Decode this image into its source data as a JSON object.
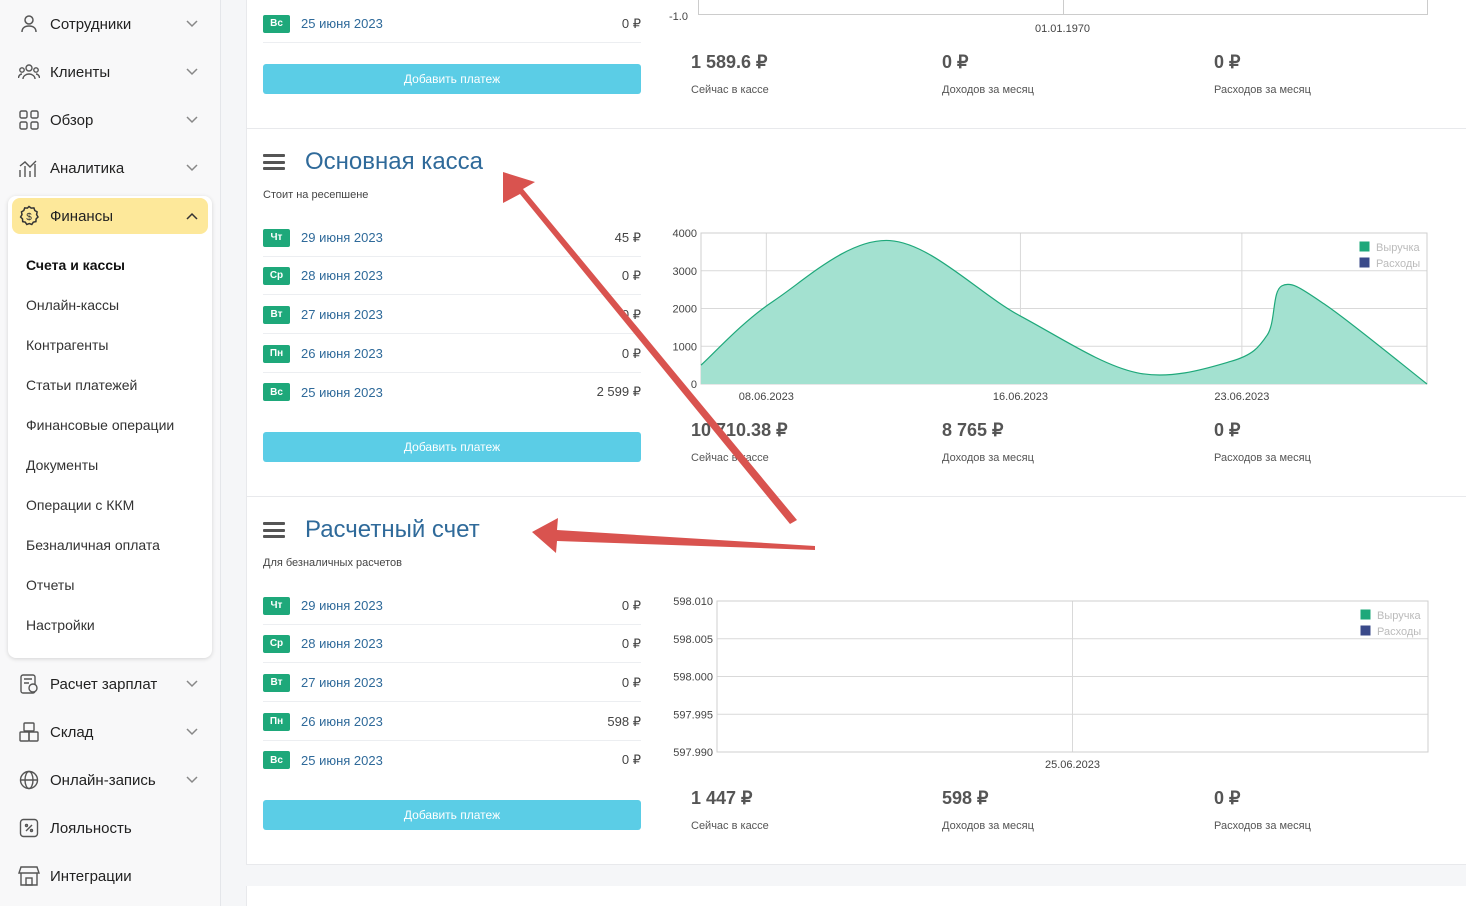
{
  "sidebar": {
    "items_top": [
      {
        "label": "Сотрудники",
        "icon": "user-icon"
      },
      {
        "label": "Клиенты",
        "icon": "users-icon"
      },
      {
        "label": "Обзор",
        "icon": "dashboard-icon"
      },
      {
        "label": "Аналитика",
        "icon": "analytics-icon"
      },
      {
        "label": "Финансы",
        "icon": "dollar-coin-icon"
      }
    ],
    "finance_sub": [
      "Счета и кассы",
      "Онлайн-кассы",
      "Контрагенты",
      "Статьи платежей",
      "Финансовые операции",
      "Документы",
      "Операции с ККМ",
      "Безналичная оплата",
      "Отчеты",
      "Настройки"
    ],
    "items_bottom": [
      {
        "label": "Расчет зарплат",
        "icon": "payroll-icon"
      },
      {
        "label": "Склад",
        "icon": "warehouse-icon"
      },
      {
        "label": "Онлайн-запись",
        "icon": "globe-icon"
      },
      {
        "label": "Лояльность",
        "icon": "discount-icon"
      },
      {
        "label": "Интеграции",
        "icon": "store-icon"
      }
    ]
  },
  "top_card": {
    "last_row": {
      "day": "Вс",
      "date": "25 июня 2023",
      "amount": "0 ₽"
    },
    "add_button": "Добавить платеж",
    "axis_min": "-1.0",
    "axis_date": "01.01.1970",
    "stats": [
      {
        "value": "1 589.6 ₽",
        "label": "Сейчас в кассе"
      },
      {
        "value": "0 ₽",
        "label": "Доходов за месяц"
      },
      {
        "value": "0 ₽",
        "label": "Расходов за месяц"
      }
    ]
  },
  "cards": [
    {
      "title": "Основная касса",
      "subtitle": "Стоит на ресепшене",
      "rows": [
        {
          "day": "Чт",
          "date": "29 июня 2023",
          "amount": "45 ₽"
        },
        {
          "day": "Ср",
          "date": "28 июня 2023",
          "amount": "0 ₽"
        },
        {
          "day": "Вт",
          "date": "27 июня 2023",
          "amount": "0 ₽"
        },
        {
          "day": "Пн",
          "date": "26 июня 2023",
          "amount": "0 ₽"
        },
        {
          "day": "Вс",
          "date": "25 июня 2023",
          "amount": "2 599 ₽"
        }
      ],
      "add_button": "Добавить платеж",
      "stats": [
        {
          "value": "10 710.38 ₽",
          "label": "Сейчас в кассе"
        },
        {
          "value": "8 765 ₽",
          "label": "Доходов за месяц"
        },
        {
          "value": "0 ₽",
          "label": "Расходов за месяц"
        }
      ]
    },
    {
      "title": "Расчетный счет",
      "subtitle": "Для безналичных расчетов",
      "rows": [
        {
          "day": "Чт",
          "date": "29 июня 2023",
          "amount": "0 ₽"
        },
        {
          "day": "Ср",
          "date": "28 июня 2023",
          "amount": "0 ₽"
        },
        {
          "day": "Вт",
          "date": "27 июня 2023",
          "amount": "0 ₽"
        },
        {
          "day": "Пн",
          "date": "26 июня 2023",
          "amount": "598 ₽"
        },
        {
          "day": "Вс",
          "date": "25 июня 2023",
          "amount": "0 ₽"
        }
      ],
      "add_button": "Добавить платеж",
      "stats": [
        {
          "value": "1 447 ₽",
          "label": "Сейчас в кассе"
        },
        {
          "value": "598 ₽",
          "label": "Доходов за месяц"
        },
        {
          "value": "0 ₽",
          "label": "Расходов за месяц"
        }
      ]
    }
  ],
  "colors": {
    "revenue": "#1ea87a",
    "revenue_fill": "#a3e1d0",
    "expenses": "#3a4a8a",
    "arrow": "#d9534f"
  },
  "chart_data": [
    {
      "type": "area",
      "x_ticks": [
        "08.06.2023",
        "16.06.2023",
        "23.06.2023"
      ],
      "y_ticks": [
        "0",
        "1000",
        "2000",
        "3000",
        "4000"
      ],
      "ylim": [
        0,
        4000
      ],
      "legend": [
        "Выручка",
        "Расходы"
      ],
      "legend_position": "top-right",
      "series": [
        {
          "name": "Выручка",
          "points": [
            [
              0,
              500
            ],
            [
              0.1,
              2200
            ],
            [
              0.26,
              3800
            ],
            [
              0.44,
              1800
            ],
            [
              0.6,
              300
            ],
            [
              0.73,
              600
            ],
            [
              0.78,
              1300
            ],
            [
              0.8,
              2600
            ],
            [
              0.86,
              2100
            ],
            [
              1.0,
              0
            ]
          ]
        }
      ]
    },
    {
      "type": "line",
      "x_ticks": [
        "25.06.2023"
      ],
      "y_ticks": [
        "597.990",
        "597.995",
        "598.000",
        "598.005",
        "598.010"
      ],
      "ylim": [
        597.99,
        598.01
      ],
      "legend": [
        "Выручка",
        "Расходы"
      ],
      "legend_position": "top-right",
      "series": []
    }
  ]
}
